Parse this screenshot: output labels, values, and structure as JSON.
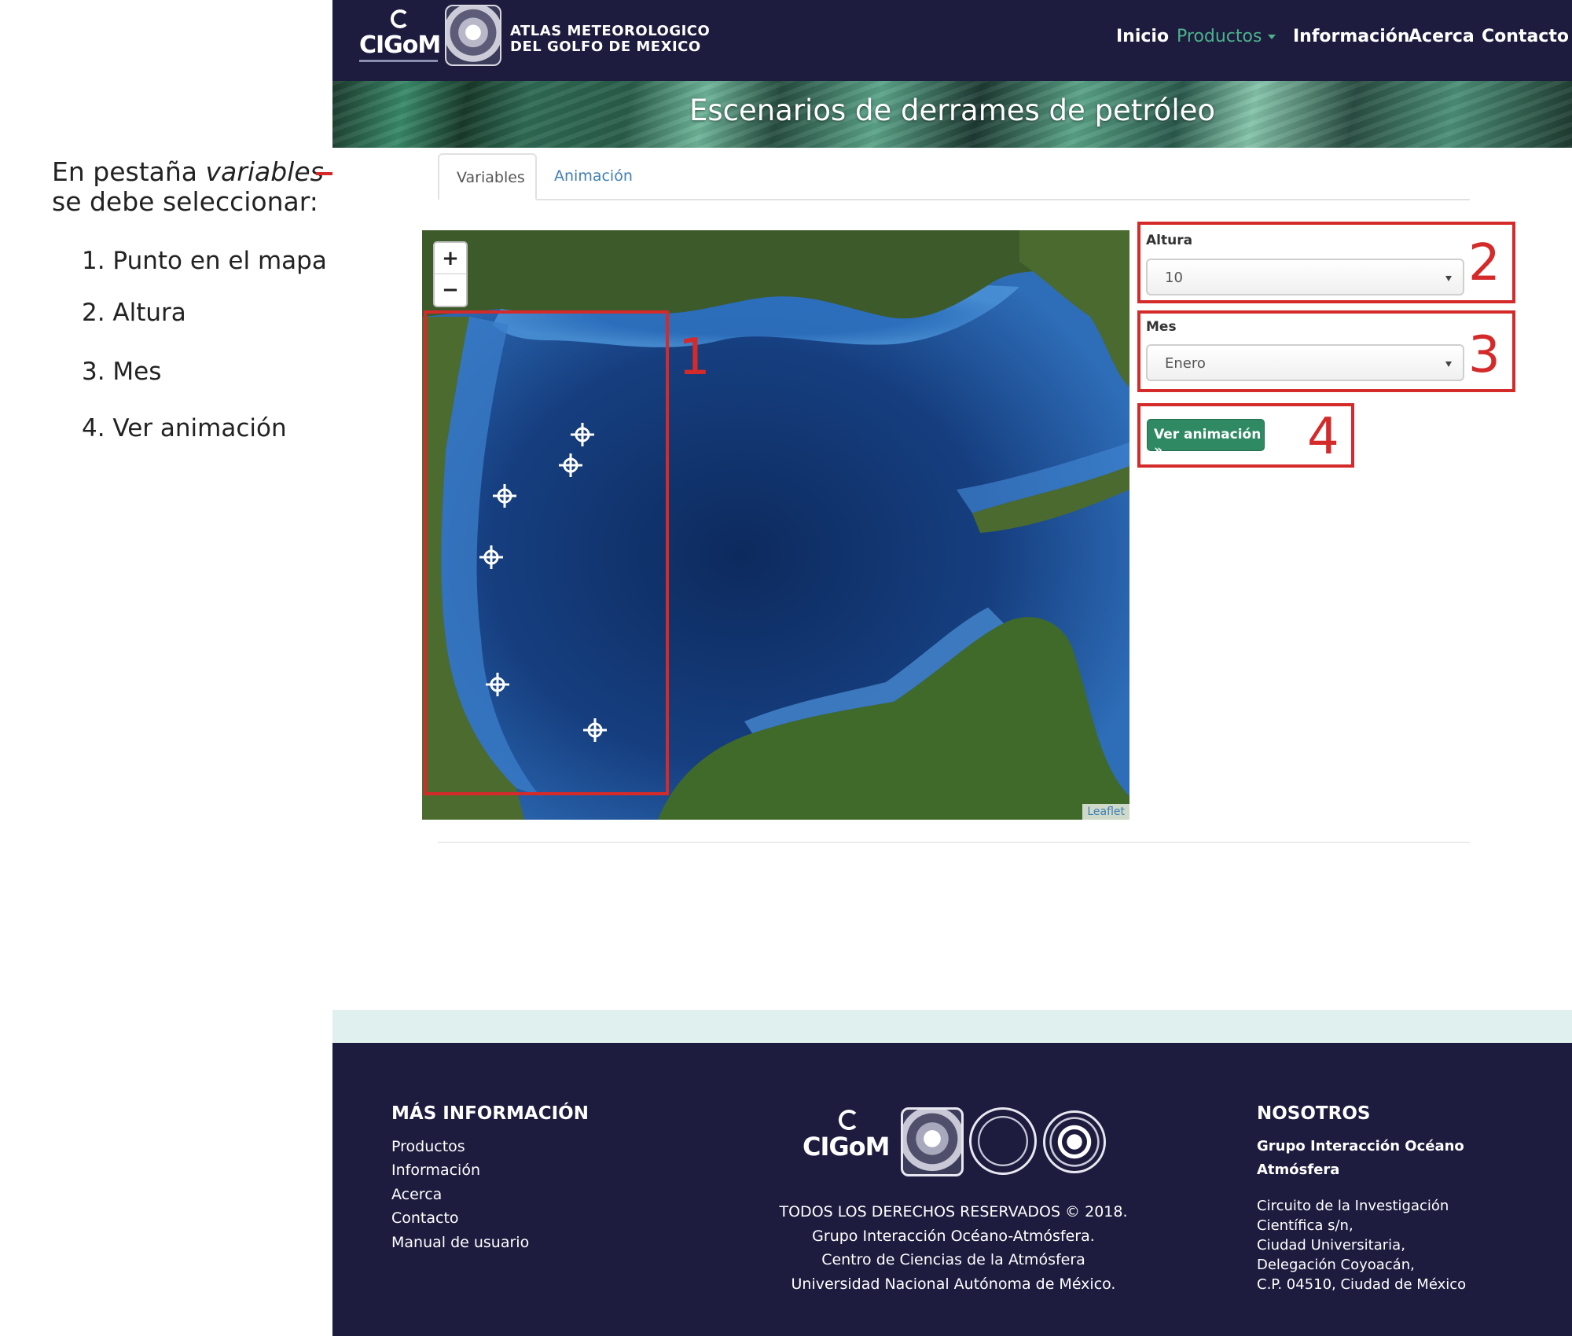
{
  "guide": {
    "intro_prefix": "En pestaña ",
    "intro_italic": "variables",
    "intro_line2": "se debe seleccionar:",
    "steps": [
      "1. Punto en el mapa",
      "2. Altura",
      "3. Mes",
      "4. Ver animación"
    ],
    "highlight_numbers": [
      "1",
      "2",
      "3",
      "4"
    ],
    "highlight_color": "#d42a2a"
  },
  "header": {
    "logo_text": "CIGoM",
    "atlas_title_line1": "ATLAS METEOROLOGICO",
    "atlas_title_line2": "DEL GOLFO DE MEXICO",
    "nav": [
      "Inicio",
      "Productos",
      "Información",
      "Acerca",
      "Contacto"
    ],
    "active_nav": "Productos",
    "background_color": "#1d1c3f",
    "accent_color": "#4cb28a"
  },
  "banner": {
    "title": "Escenarios de derrames de petróleo"
  },
  "tabs": [
    {
      "label": "Variables",
      "active": true
    },
    {
      "label": "Animación",
      "active": false
    }
  ],
  "map": {
    "zoom_in": "+",
    "zoom_out": "−",
    "attribution": "Leaflet",
    "marker_icon": "crosshair-marker-icon",
    "marker_count": 6
  },
  "form": {
    "altura_label": "Altura",
    "altura_value": "10",
    "mes_label": "Mes",
    "mes_value": "Enero",
    "button_label": "Ver animación »",
    "button_color": "#2f8a64"
  },
  "footer": {
    "mas_info_heading": "MÁS INFORMACIÓN",
    "links": [
      "Productos",
      "Información",
      "Acerca",
      "Contacto",
      "Manual de usuario"
    ],
    "logo_text": "CIGoM",
    "center_lines": [
      "TODOS LOS DERECHOS RESERVADOS © 2018.",
      "Grupo Interacción Océano-Atmósfera.",
      "Centro de Ciencias de la Atmósfera",
      "Universidad Nacional Autónoma de México."
    ],
    "nosotros_heading": "NOSOTROS",
    "group_name_line1": "Grupo Interacción Océano",
    "group_name_line2": "Atmósfera",
    "address_lines": [
      "Circuito de la Investigación",
      "Científica s/n,",
      "Ciudad Universitaria,",
      "Delegación Coyoacán,",
      "C.P. 04510, Ciudad de México"
    ]
  }
}
